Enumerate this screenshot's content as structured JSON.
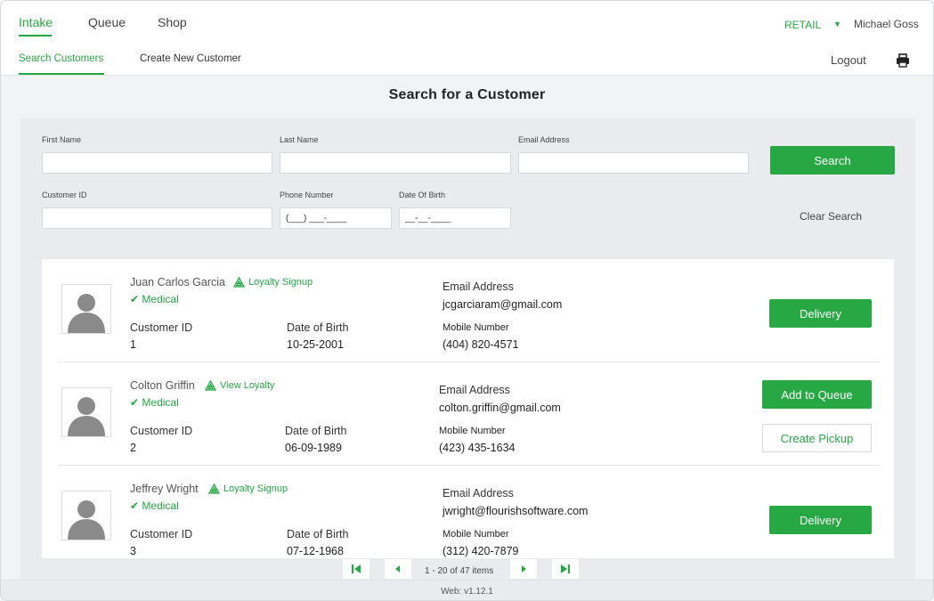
{
  "nav": {
    "tabs": [
      {
        "label": "Intake",
        "active": true
      },
      {
        "label": "Queue",
        "active": false
      },
      {
        "label": "Shop",
        "active": false
      }
    ],
    "subtabs": [
      {
        "label": "Search Customers",
        "active": true
      },
      {
        "label": "Create New Customer",
        "active": false
      }
    ],
    "store": "RETAIL",
    "user": "Michael Goss",
    "logout": "Logout"
  },
  "page_title": "Search for a Customer",
  "search": {
    "first_name_label": "First Name",
    "last_name_label": "Last Name",
    "email_label": "Email Address",
    "customer_id_label": "Customer ID",
    "phone_label": "Phone Number",
    "phone_placeholder": "(___) ___-____",
    "dob_label": "Date Of Birth",
    "dob_placeholder": "__-__-____",
    "search_button": "Search",
    "clear_button": "Clear Search"
  },
  "customers": [
    {
      "name": "Juan Carlos Garcia",
      "loyalty": "Loyalty Signup",
      "medical": "Medical",
      "customer_id_label": "Customer ID",
      "customer_id": "1",
      "dob_label": "Date of Birth",
      "dob": "10-25-2001",
      "email_label": "Email Address",
      "email": "jcgarciaram@gmail.com",
      "mobile_label": "Mobile Number",
      "mobile": "(404) 820-4571",
      "action_primary": "Delivery"
    },
    {
      "name": "Colton Griffin",
      "loyalty": "View Loyalty",
      "medical": "Medical",
      "customer_id_label": "Customer ID",
      "customer_id": "2",
      "dob_label": "Date of Birth",
      "dob": "06-09-1989",
      "email_label": "Email Address",
      "email": "colton.griffin@gmail.com",
      "mobile_label": "Mobile Number",
      "mobile": "(423) 435-1634",
      "action_primary": "Add to Queue",
      "action_secondary": "Create Pickup"
    },
    {
      "name": "Jeffrey Wright",
      "loyalty": "Loyalty Signup",
      "medical": "Medical",
      "customer_id_label": "Customer ID",
      "customer_id": "3",
      "dob_label": "Date of Birth",
      "dob": "07-12-1968",
      "email_label": "Email Address",
      "email": "jwright@flourishsoftware.com",
      "mobile_label": "Mobile Number",
      "mobile": "(312) 420-7879",
      "action_primary": "Delivery"
    }
  ],
  "pagination": {
    "range_text": "1 - 20 of 47 items"
  },
  "footer": {
    "version": "Web: v1.12.1"
  },
  "colors": {
    "accent": "#27a844",
    "panel": "#e9ebee",
    "background": "#f2f3f5"
  }
}
